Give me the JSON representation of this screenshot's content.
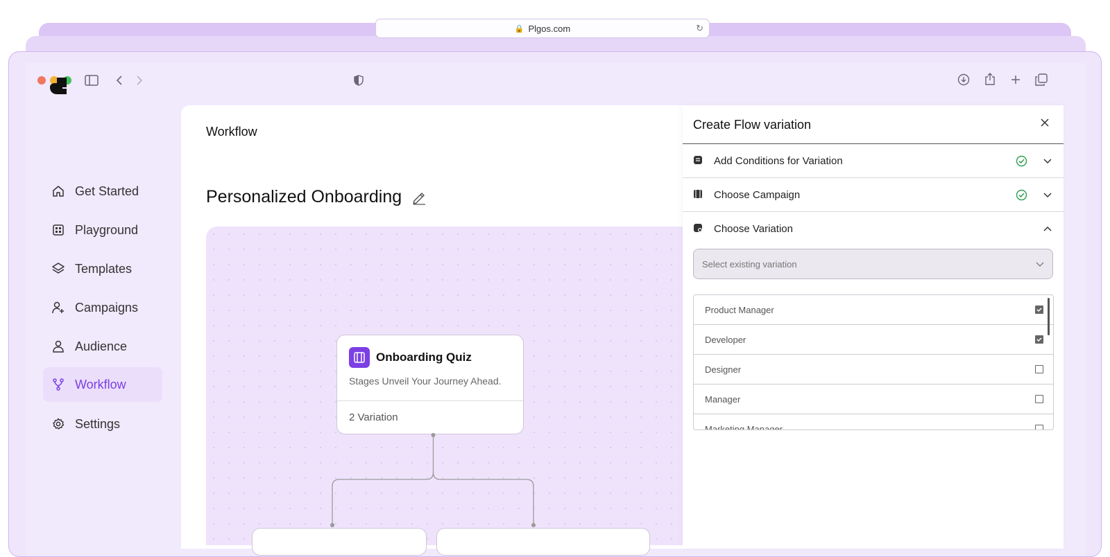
{
  "browser": {
    "url": "Plgos.com",
    "traffic_lights": [
      "#ee7860",
      "#f2b134",
      "#3fbf5c"
    ]
  },
  "sidebar": {
    "items": [
      {
        "label": "Get Started",
        "icon": "home-icon"
      },
      {
        "label": "Playground",
        "icon": "grid-icon"
      },
      {
        "label": "Templates",
        "icon": "layers-icon"
      },
      {
        "label": "Campaigns",
        "icon": "user-plus-icon"
      },
      {
        "label": "Audience",
        "icon": "user-icon"
      },
      {
        "label": "Workflow",
        "icon": "workflow-icon",
        "active": true
      },
      {
        "label": "Settings",
        "icon": "gear-icon"
      }
    ]
  },
  "main": {
    "breadcrumb": "Workflow",
    "title": "Personalized Onboarding",
    "node": {
      "title": "Onboarding Quiz",
      "subtitle": "Stages Unveil Your Journey Ahead.",
      "footer": "2 Variation"
    }
  },
  "drawer": {
    "title": "Create Flow variation",
    "sections": [
      {
        "label": "Add Conditions for Variation",
        "done": true,
        "expanded": false
      },
      {
        "label": "Choose Campaign",
        "done": true,
        "expanded": false
      },
      {
        "label": "Choose Variation",
        "done": false,
        "expanded": true
      }
    ],
    "select_placeholder": "Select existing variation",
    "options": [
      {
        "label": "Product Manager",
        "checked": true
      },
      {
        "label": "Developer",
        "checked": true
      },
      {
        "label": "Designer",
        "checked": false
      },
      {
        "label": "Manager",
        "checked": false
      },
      {
        "label": "Marketing Manager",
        "checked": false
      }
    ]
  },
  "colors": {
    "accent": "#7b3fe4",
    "success": "#2e9e4f"
  }
}
